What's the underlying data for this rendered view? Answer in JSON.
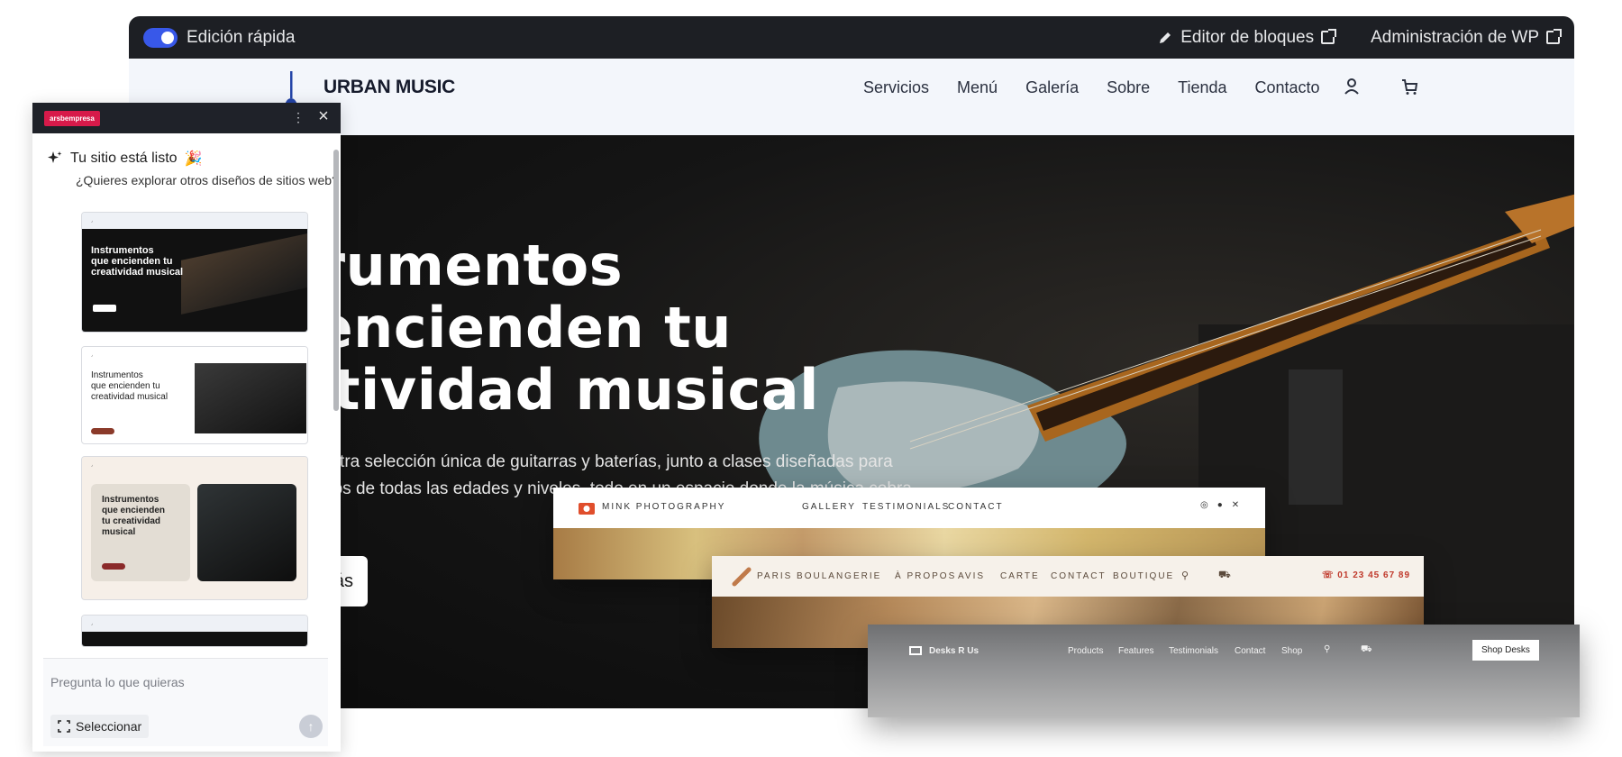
{
  "wpbar": {
    "quick_edit_label": "Edición rápida",
    "block_editor_label": "Editor de bloques",
    "wp_admin_label": "Administración de WP"
  },
  "site": {
    "brand": "URBAN MUSIC",
    "nav": [
      "Servicios",
      "Menú",
      "Galería",
      "Sobre",
      "Tienda",
      "Contacto"
    ],
    "hero_title_lines": [
      "strumentos",
      "e encienden tu",
      "eatividad musical"
    ],
    "hero_subtitle_lines": [
      "e nuestra selección única de guitarras y baterías, junto a clases diseñadas para",
      "músicos de todas las edades y niveles, todo en un espacio donde la música cobra"
    ],
    "hero_button": "ce más"
  },
  "cards": {
    "mink": {
      "brand": "MINK PHOTOGRAPHY",
      "nav": [
        "GALLERY",
        "TESTIMONIALS",
        "CONTACT"
      ]
    },
    "paris": {
      "brand": "PARIS BOULANGERIE",
      "nav": [
        "À PROPOS",
        "AVIS",
        "CARTE",
        "CONTACT",
        "BOUTIQUE"
      ],
      "phone": "01 23 45 67 89"
    },
    "desks": {
      "brand": "Desks R Us",
      "nav": [
        "Products",
        "Features",
        "Testimonials",
        "Contact",
        "Shop"
      ],
      "cta": "Shop Desks"
    }
  },
  "panel": {
    "logo_text": "arsbempresa",
    "ready_text": "Tu sitio está listo",
    "explore_text": "¿Quieres explorar otros diseños de sitios web?",
    "thumb_title_lines": [
      "Instrumentos",
      "que encienden tu",
      "creatividad musical"
    ],
    "thumb3_title_lines": [
      "Instrumentos",
      "que encienden",
      "tu creatividad",
      "musical"
    ],
    "input_placeholder": "Pregunta lo que quieras",
    "select_label": "Seleccionar"
  },
  "colors": {
    "accent": "#3858e9",
    "panel_badge": "#d71a4a",
    "paris_phone": "#c0392b"
  }
}
